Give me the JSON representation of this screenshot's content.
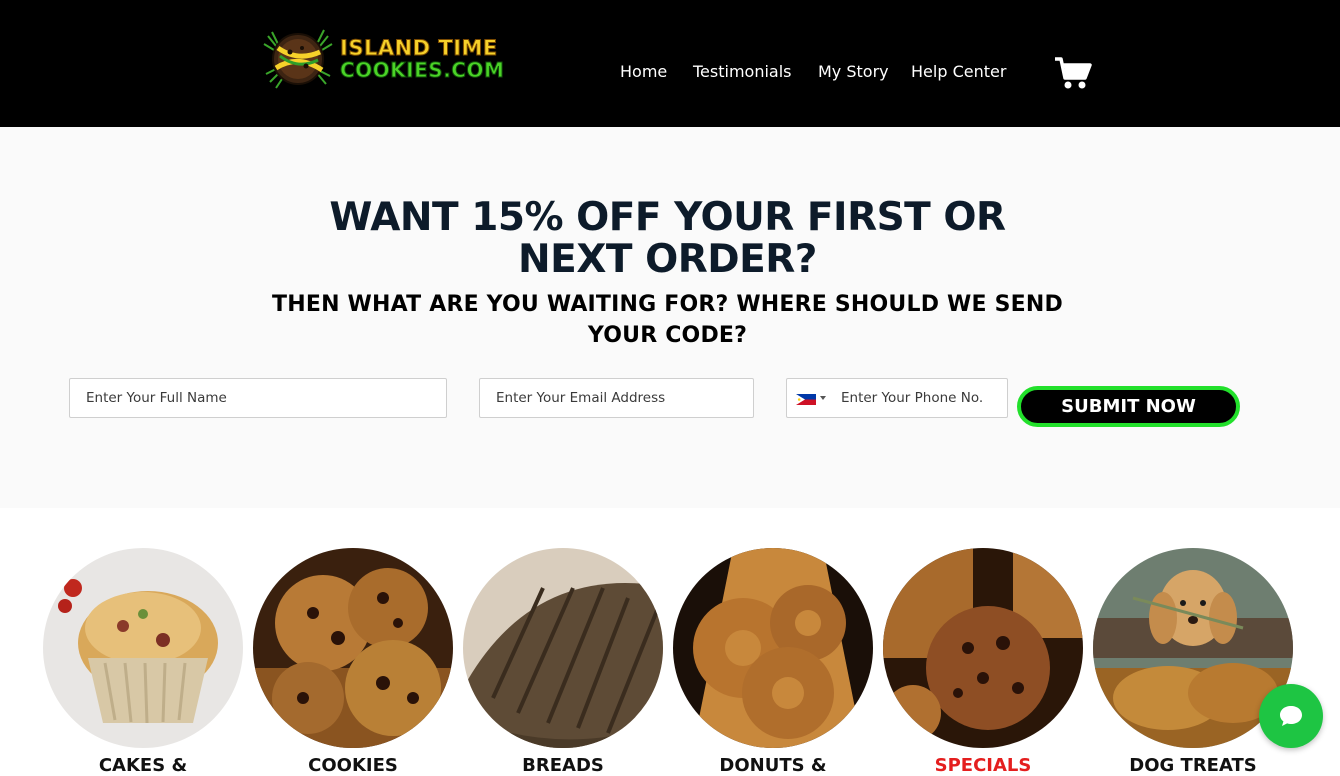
{
  "header": {
    "logo": {
      "line1": "ISLAND TIME",
      "line2": "COOKIES.COM"
    },
    "nav": [
      {
        "label": "Home"
      },
      {
        "label": "Testimonials"
      },
      {
        "label": "My Story"
      },
      {
        "label": "Help Center"
      }
    ],
    "cart_icon": "shopping-cart-icon"
  },
  "promo": {
    "headline": "WANT 15% OFF YOUR FIRST OR NEXT ORDER?",
    "subline": "THEN WHAT ARE YOU WAITING FOR? WHERE SHOULD WE SEND YOUR CODE?",
    "name_placeholder": "Enter Your Full Name",
    "email_placeholder": "Enter Your Email Address",
    "phone_placeholder": "Enter Your Phone No.",
    "phone_country_icon": "philippines-flag-icon",
    "submit_label": "SUBMIT NOW"
  },
  "categories": [
    {
      "label": "CAKES &"
    },
    {
      "label": "COOKIES"
    },
    {
      "label": "BREADS"
    },
    {
      "label": "DONUTS &"
    },
    {
      "label": "SPECIALS"
    },
    {
      "label": "DOG TREATS"
    }
  ],
  "colors": {
    "header_bg": "#000000",
    "headline": "#0d1b2a",
    "submit_border": "#22e02b",
    "specials_label": "#e41e1e",
    "chat_bubble": "#1ec543"
  },
  "chat_icon": "chat-bubble-icon"
}
